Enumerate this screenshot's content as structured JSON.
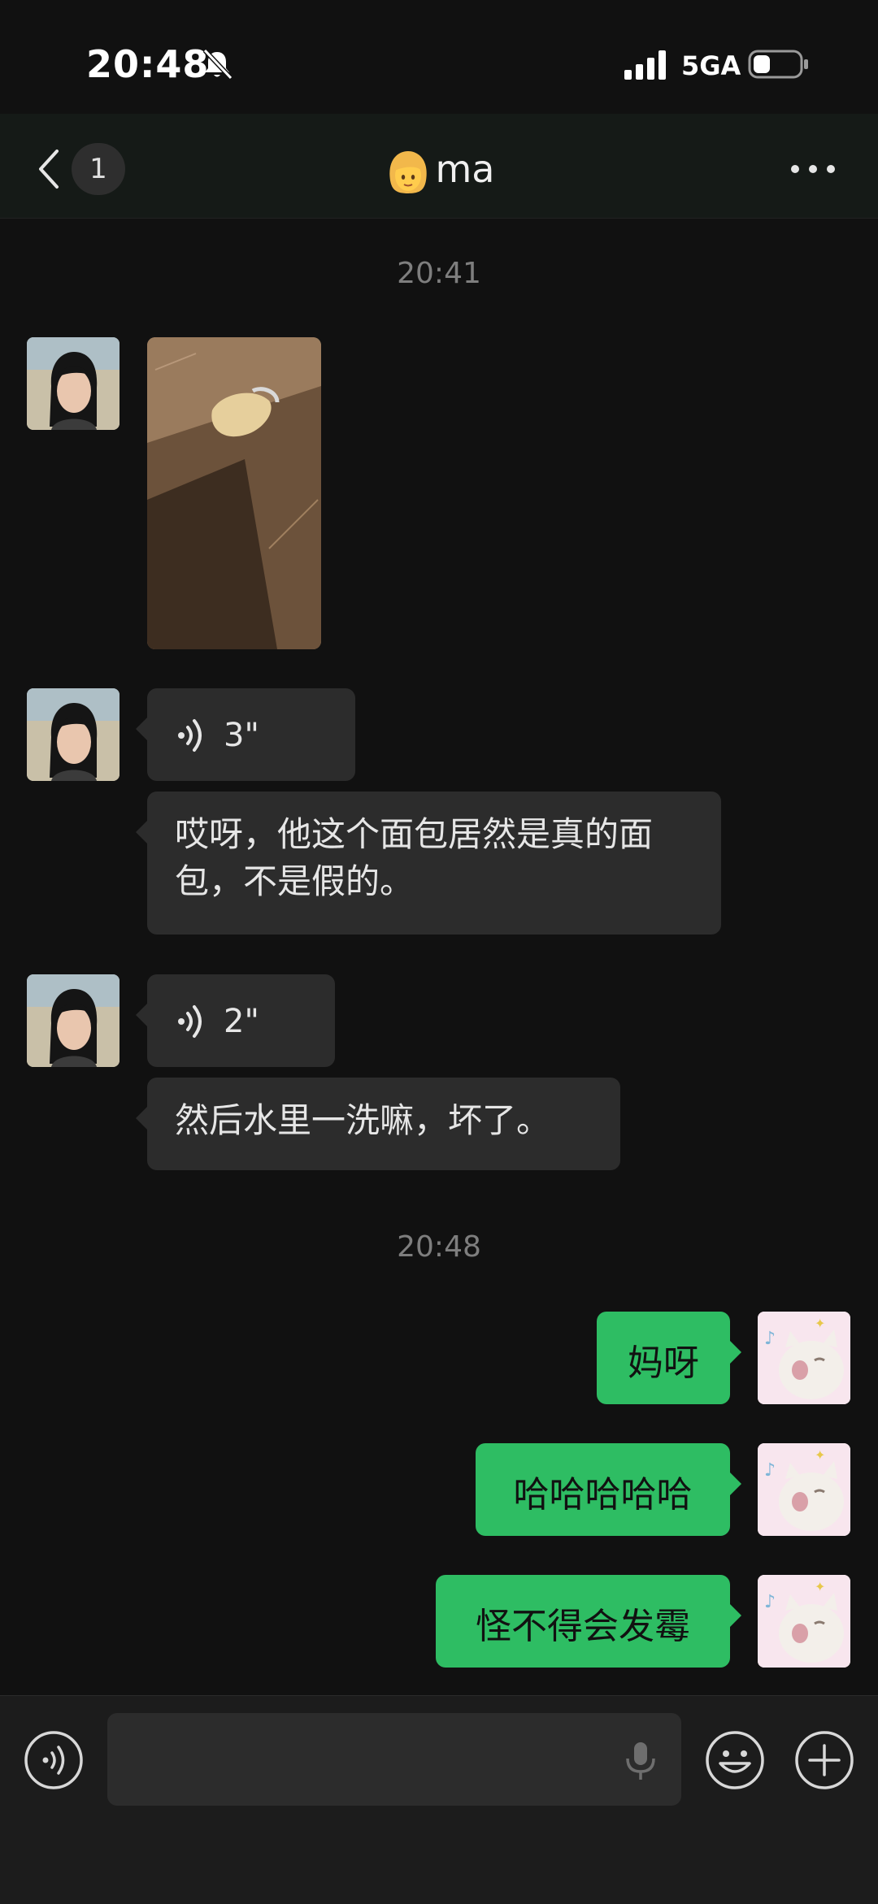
{
  "status_bar": {
    "time": "20:48",
    "network": "5GA"
  },
  "header": {
    "back_badge": "1",
    "title": "ma"
  },
  "messages": {
    "timestamp_1": "20:41",
    "voice_1": "3\"",
    "text_1": "哎呀，他这个面包居然是真的面包，不是假的。",
    "voice_2": "2\"",
    "text_2": "然后水里一洗嘛，坏了。",
    "timestamp_2": "20:48",
    "sent_1": "妈呀",
    "sent_2": "哈哈哈哈哈",
    "sent_3": "怪不得会发霉"
  },
  "colors": {
    "sent_bubble": "#2ebd63",
    "received_bubble": "#2c2c2c",
    "background": "#111111"
  }
}
